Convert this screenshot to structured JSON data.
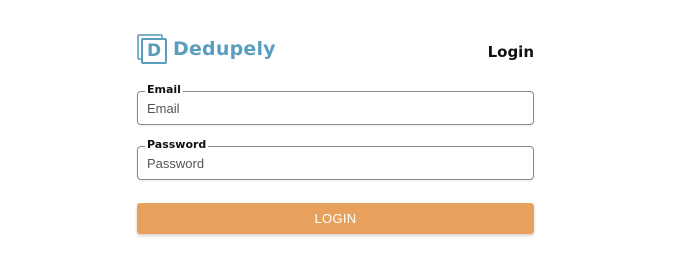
{
  "brand": {
    "name": "Dedupely",
    "logo_letter": "D",
    "color": "#5b9dbf"
  },
  "page": {
    "heading": "Login"
  },
  "form": {
    "email": {
      "label": "Email",
      "placeholder": "Email",
      "value": ""
    },
    "password": {
      "label": "Password",
      "placeholder": "Password",
      "value": ""
    },
    "submit_label": "LOGIN",
    "submit_color": "#e8a15c"
  }
}
